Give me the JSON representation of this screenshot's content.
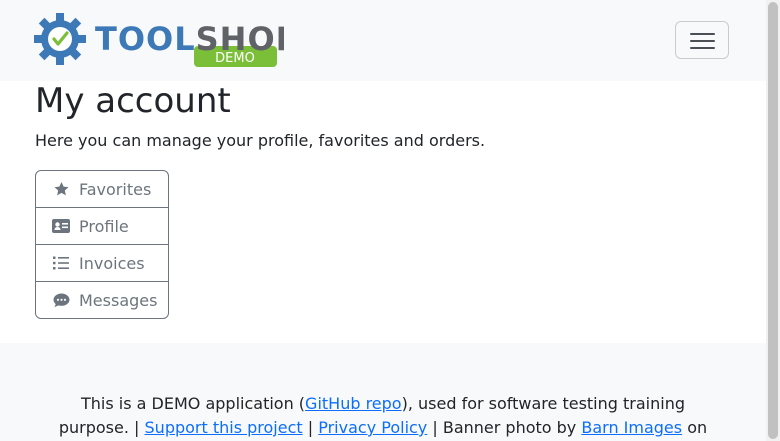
{
  "brand": {
    "name_part1": "TOOL",
    "name_part2": "SHOP",
    "badge": "DEMO",
    "colors": {
      "blue": "#3d79b6",
      "gray": "#5f6368",
      "green": "#7bbf38"
    }
  },
  "navbar": {
    "toggle_icon": "hamburger-icon"
  },
  "main": {
    "title": "My account",
    "intro": "Here you can manage your profile, favorites and orders.",
    "menu": [
      {
        "label": "Favorites",
        "icon": "star-icon"
      },
      {
        "label": "Profile",
        "icon": "id-card-icon"
      },
      {
        "label": "Invoices",
        "icon": "list-icon"
      },
      {
        "label": "Messages",
        "icon": "comment-icon"
      }
    ]
  },
  "footer": {
    "text1": "This is a DEMO application (",
    "link_github": "GitHub repo",
    "text2": "), used for software testing training purpose. | ",
    "link_support": "Support this project",
    "text3": " | ",
    "link_privacy": "Privacy Policy",
    "text4": " | Banner photo by ",
    "link_barn": "Barn Images",
    "text5": " on"
  }
}
